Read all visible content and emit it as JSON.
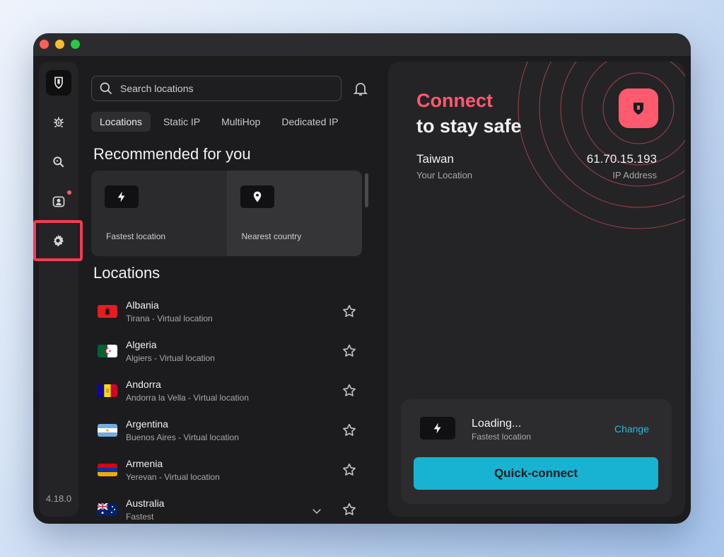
{
  "colors": {
    "accent_red": "#ff5a6e",
    "accent_cyan": "#18b3d2",
    "highlight_box": "#f23b52"
  },
  "sidebar": {
    "items": [
      {
        "icon": "shield-logo-icon"
      },
      {
        "icon": "bug-icon"
      },
      {
        "icon": "search-magnify-icon"
      },
      {
        "icon": "profile-icon",
        "notification": true
      },
      {
        "icon": "gear-icon",
        "highlighted": true
      }
    ],
    "version": "4.18.0"
  },
  "search": {
    "placeholder": "Search locations"
  },
  "tabs": [
    "Locations",
    "Static IP",
    "MultiHop",
    "Dedicated IP"
  ],
  "recommended": {
    "title": "Recommended for you",
    "cards": [
      {
        "icon": "lightning-icon",
        "label": "Fastest location"
      },
      {
        "icon": "pin-icon",
        "label": "Nearest country"
      }
    ]
  },
  "locations": {
    "title": "Locations",
    "items": [
      {
        "name": "Albania",
        "sub": "Tirana - Virtual location",
        "flag": "albania"
      },
      {
        "name": "Algeria",
        "sub": "Algiers - Virtual location",
        "flag": "algeria"
      },
      {
        "name": "Andorra",
        "sub": "Andorra la Vella - Virtual location",
        "flag": "andorra"
      },
      {
        "name": "Argentina",
        "sub": "Buenos Aires - Virtual location",
        "flag": "argentina"
      },
      {
        "name": "Armenia",
        "sub": "Yerevan - Virtual location",
        "flag": "armenia"
      },
      {
        "name": "Australia",
        "sub": "Fastest",
        "flag": "australia",
        "expandable": true
      }
    ]
  },
  "status": {
    "headline_1": "Connect",
    "headline_2": "to stay safe",
    "country": "Taiwan",
    "country_caption": "Your Location",
    "ip": "61.70.15.193",
    "ip_caption": "IP Address"
  },
  "connect_card": {
    "title": "Loading...",
    "subtitle": "Fastest location",
    "change_label": "Change",
    "button_label": "Quick-connect"
  }
}
